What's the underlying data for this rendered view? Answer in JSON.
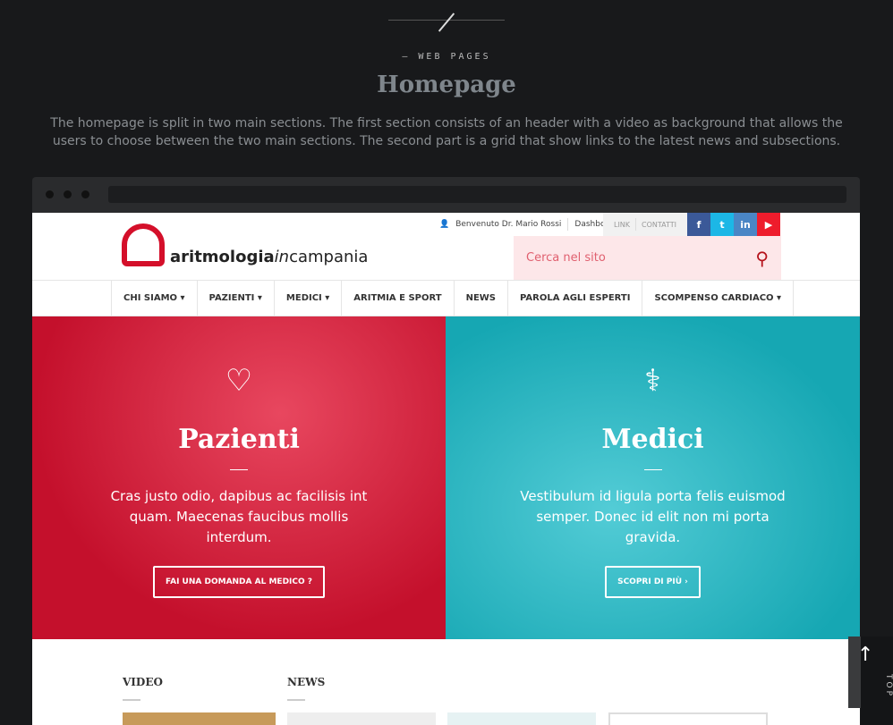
{
  "header": {
    "eyebrow": "— WEB PAGES",
    "title": "Homepage",
    "description": "The homepage is split in two main sections. The first section consists of an header with a video as background that allows the users to choose between the two main sections. The second part is a grid that show links to the latest news and subsections."
  },
  "site": {
    "logo_bold": "aritmologia",
    "logo_italic": "in",
    "logo_rest": "campania",
    "user": "Benvenuto Dr. Mario Rossi",
    "dashboard": "Dashboard",
    "links": [
      "LINK",
      "CONTATTI"
    ],
    "social": [
      "f",
      "t",
      "in",
      "▶"
    ],
    "search_placeholder": "Cerca nel sito",
    "nav": [
      "CHI SIAMO ▾",
      "PAZIENTI ▾",
      "MEDICI ▾",
      "ARITMIA E SPORT",
      "NEWS",
      "PAROLA AGLI ESPERTI",
      "SCOMPENSO CARDIACO ▾"
    ],
    "hero_left": {
      "title": "Pazienti",
      "text": "Cras justo odio, dapibus ac facilisis int quam. Maecenas faucibus mollis interdum.",
      "button": "FAI UNA DOMANDA AL MEDICO  ?"
    },
    "hero_right": {
      "title": "Medici",
      "text": "Vestibulum id ligula porta felis euismod semper. Donec id elit non mi porta gravida.",
      "button": "SCOPRI DI PIÙ  ›"
    },
    "sections": [
      "VIDEO",
      "NEWS"
    ]
  },
  "totop": "TOP",
  "colors": {
    "red": "#c4102c",
    "teal": "#16a7b3"
  }
}
